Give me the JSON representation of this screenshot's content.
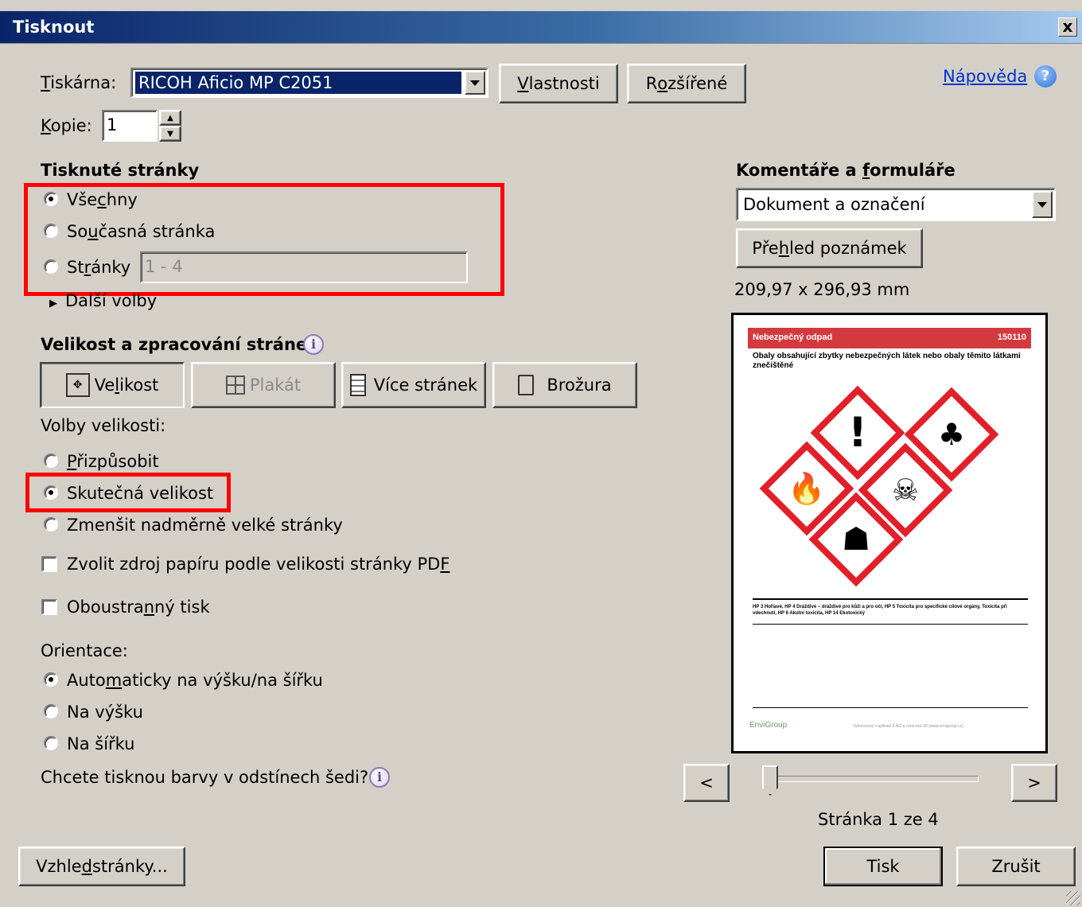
{
  "window": {
    "title": "Tisknout",
    "close_glyph": "x"
  },
  "printer": {
    "label_u": "T",
    "label_rest": "iskárna:",
    "value": "RICOH Aficio MP C2051",
    "properties_u": "V",
    "properties_rest": "lastnosti",
    "advanced_pre": "R",
    "advanced_u": "o",
    "advanced_rest": "zšířené"
  },
  "help": {
    "label": "Nápověda",
    "icon": "help-icon"
  },
  "copies": {
    "label_u": "K",
    "label_rest": "opie:",
    "value": "1"
  },
  "pages": {
    "heading": "Tisknuté stránky",
    "all_pre": "Vše",
    "all_u": "c",
    "all_rest": "hny",
    "current_pre": "So",
    "current_u": "u",
    "current_rest": "časná stránka",
    "range_pre": "St",
    "range_u": "r",
    "range_rest": "ánky",
    "range_placeholder": "1 - 4",
    "more_options": "Další volby",
    "selected": "all"
  },
  "sizing": {
    "heading": "Velikost a zpracování stránek",
    "tabs": {
      "size_pre": "Ve",
      "size_u": "l",
      "size_rest": "ikost",
      "poster": "Plakát",
      "multiple": "Více stránek",
      "booklet": "Brožura"
    },
    "options_label": "Volby velikosti:",
    "fit_u": "P",
    "fit_rest": "řizpůsobit",
    "actual": "Skutečná velikost",
    "shrink": "Zmenšit nadměrně velké stránky",
    "paper_source_pre": "Zvolit zdroj papíru podle velikosti stránky PD",
    "paper_source_u": "F",
    "duplex_pre": "Oboustra",
    "duplex_u": "n",
    "duplex_rest": "ný tisk",
    "selected": "actual",
    "paper_source_checked": false,
    "duplex_checked": false
  },
  "orientation": {
    "label": "Orientace:",
    "auto_pre": "Auto",
    "auto_u": "m",
    "auto_rest": "aticky na výšku/na šířku",
    "portrait": "Na výšku",
    "landscape": "Na šířku",
    "selected": "auto"
  },
  "grayscale_question": "Chcete tisknou barvy v odstínech šedi?",
  "comments": {
    "heading_pre": "Komentáře a ",
    "heading_u": "f",
    "heading_rest": "ormuláře",
    "value": "Dokument a označení",
    "summary_pre": "Pře",
    "summary_u": "h",
    "summary_rest": "led poznámek"
  },
  "page_size": "209,97 x 296,93 mm",
  "preview_doc": {
    "banner_left": "Nebezpečný odpad",
    "banner_right": "150110",
    "subtitle": "Obaly obsahující zbytky nebezpečných látek nebo obaly těmito látkami znečištěné",
    "hazards": "HP 3 Hořlavé, HP 4 Dráždivé – dráždivé pro kůži a pro oči, HP 5 Toxicita pro specifické cílové orgány, Toxicita při vdechnutí, HP 6 Akutní toxicita, HP 14 Ekotoxický",
    "footer_logo": "EnviGroup",
    "footer_text": "Vyhotoveno v aplikaci ILNO a vzorcové 90 (www.envigroup.cz)",
    "pictograms": [
      "exclamation-pictogram",
      "environment-pictogram",
      "flame-pictogram",
      "skull-pictogram",
      "health-hazard-pictogram"
    ],
    "accent": "#e1202a"
  },
  "nav": {
    "prev": "<",
    "next": ">",
    "page_status": "Stránka 1 ze 4",
    "slider_fraction": 0.0
  },
  "footer": {
    "page_setup_pre": "Vzhle",
    "page_setup_u": "d",
    "page_setup_rest": " stránky...",
    "print": "Tisk",
    "cancel": "Zrušit"
  },
  "colors": {
    "face": "#d4d0c8",
    "highlight_red": "#ff0000",
    "title_blue": "#0a246a",
    "link_blue": "#0033cc"
  }
}
